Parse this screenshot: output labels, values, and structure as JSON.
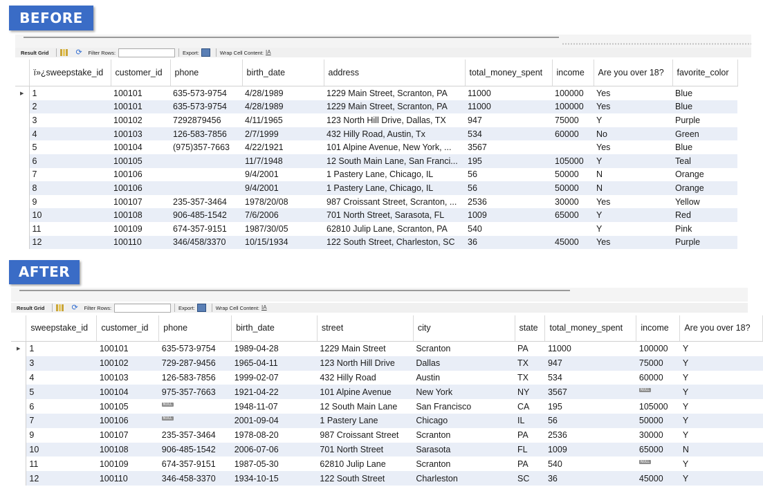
{
  "before": {
    "banner": "BEFORE",
    "toolbar": {
      "result_grid": "Result Grid",
      "filter_rows": "Filter Rows:",
      "export": "Export:",
      "wrap_cell": "Wrap Cell Content:"
    },
    "columns": [
      "ï»¿sweepstake_id",
      "customer_id",
      "phone",
      "birth_date",
      "address",
      "total_money_spent",
      "income",
      "Are you over 18?",
      "favorite_color"
    ],
    "rows": [
      [
        "1",
        "100101",
        "635-573-9754",
        "4/28/1989",
        "1229 Main Street, Scranton, PA",
        "11000",
        "100000",
        "Yes",
        "Blue"
      ],
      [
        "2",
        "100101",
        "635-573-9754",
        "4/28/1989",
        "1229 Main Street, Scranton, PA",
        "11000",
        "100000",
        "Yes",
        "Blue"
      ],
      [
        "3",
        "100102",
        "7292879456",
        "4/11/1965",
        "123 North Hill Drive, Dallas, TX",
        "947",
        "75000",
        "Y",
        "Purple"
      ],
      [
        "4",
        "100103",
        "126-583-7856",
        "2/7/1999",
        "432 Hilly Road, Austin, Tx",
        "534",
        "60000",
        "No",
        "Green"
      ],
      [
        "5",
        "100104",
        "(975)357-7663",
        "4/22/1921",
        "101 Alpine Avenue, New York, ...",
        "3567",
        "",
        "Yes",
        "Blue"
      ],
      [
        "6",
        "100105",
        "",
        "11/7/1948",
        "12 South Main Lane, San Franci...",
        "195",
        "105000",
        "Y",
        "Teal"
      ],
      [
        "7",
        "100106",
        "",
        "9/4/2001",
        "1 Pastery Lane, Chicago, IL",
        "56",
        "50000",
        "N",
        "Orange"
      ],
      [
        "8",
        "100106",
        "",
        "9/4/2001",
        "1 Pastery Lane, Chicago, IL",
        "56",
        "50000",
        "N",
        "Orange"
      ],
      [
        "9",
        "100107",
        "235-357-3464",
        "1978/20/08",
        "987 Croissant Street, Scranton, ...",
        "2536",
        "30000",
        "Yes",
        "Yellow"
      ],
      [
        "10",
        "100108",
        "906-485-1542",
        "7/6/2006",
        "701 North Street, Sarasota, FL",
        "1009",
        "65000",
        "Y",
        "Red"
      ],
      [
        "11",
        "100109",
        "674-357-9151",
        "1987/30/05",
        "62810 Julip Lane, Scranton, PA",
        "540",
        "",
        "Y",
        "Pink"
      ],
      [
        "12",
        "100110",
        "346/458/3370",
        "10/15/1934",
        "122 South Street, Charleston, SC",
        "36",
        "45000",
        "Yes",
        "Purple"
      ]
    ]
  },
  "after": {
    "banner": "AFTER",
    "toolbar": {
      "result_grid": "Result Grid",
      "filter_rows": "Filter Rows:",
      "export": "Export:",
      "wrap_cell": "Wrap Cell Content:"
    },
    "null_label": "NULL",
    "columns": [
      "sweepstake_id",
      "customer_id",
      "phone",
      "birth_date",
      "street",
      "city",
      "state",
      "total_money_spent",
      "income",
      "Are you over 18?"
    ],
    "rows": [
      [
        "1",
        "100101",
        "635-573-9754",
        "1989-04-28",
        "1229 Main Street",
        "Scranton",
        "PA",
        "11000",
        "100000",
        "Y"
      ],
      [
        "3",
        "100102",
        "729-287-9456",
        "1965-04-11",
        "123 North Hill Drive",
        "Dallas",
        "TX",
        "947",
        "75000",
        "Y"
      ],
      [
        "4",
        "100103",
        "126-583-7856",
        "1999-02-07",
        "432 Hilly Road",
        "Austin",
        "TX",
        "534",
        "60000",
        "Y"
      ],
      [
        "5",
        "100104",
        "975-357-7663",
        "1921-04-22",
        "101 Alpine Avenue",
        "New York",
        "NY",
        "3567",
        null,
        "Y"
      ],
      [
        "6",
        "100105",
        null,
        "1948-11-07",
        "12 South Main Lane",
        "San Francisco",
        "CA",
        "195",
        "105000",
        "Y"
      ],
      [
        "7",
        "100106",
        null,
        "2001-09-04",
        "1 Pastery Lane",
        "Chicago",
        "IL",
        "56",
        "50000",
        "Y"
      ],
      [
        "9",
        "100107",
        "235-357-3464",
        "1978-08-20",
        "987 Croissant Street",
        "Scranton",
        "PA",
        "2536",
        "30000",
        "Y"
      ],
      [
        "10",
        "100108",
        "906-485-1542",
        "2006-07-06",
        "701 North Street",
        "Sarasota",
        "FL",
        "1009",
        "65000",
        "N"
      ],
      [
        "11",
        "100109",
        "674-357-9151",
        "1987-05-30",
        "62810 Julip Lane",
        "Scranton",
        "PA",
        "540",
        null,
        "Y"
      ],
      [
        "12",
        "100110",
        "346-458-3370",
        "1934-10-15",
        "122 South Street",
        "Charleston",
        "SC",
        "36",
        "45000",
        "Y"
      ]
    ]
  },
  "colors": {
    "banner": "#3a6cc6",
    "alt_row": "#e9eef7",
    "null_badge": "#8c8c8c"
  },
  "icons": {
    "row_marker": "row-pointer-icon",
    "grid": "grid-icon",
    "refresh": "refresh-icon",
    "export": "export-icon",
    "wrap": "wrap-cell-icon"
  }
}
